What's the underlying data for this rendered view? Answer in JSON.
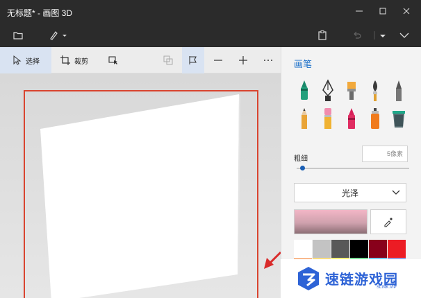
{
  "window": {
    "title": "无标题* - 画图 3D"
  },
  "toolbar": {
    "select_label": "选择",
    "crop_label": "裁剪"
  },
  "panel": {
    "title": "画笔",
    "thickness_label": "粗细",
    "thickness_value": "5像素",
    "thickness_fraction": 0.03,
    "material": "光泽",
    "brushes": [
      "marker-icon",
      "calligraphy-pen-icon",
      "oil-brush-icon",
      "watercolor-icon",
      "pixel-pen-icon",
      "pencil-icon",
      "eraser-icon",
      "crayon-icon",
      "spray-can-icon",
      "fill-bucket-icon"
    ],
    "palette": [
      "#ffffff",
      "#c3c3c3",
      "#585858",
      "#000000",
      "#88001b",
      "#ec1c24",
      "#ff7f27",
      "#ffc90e",
      "#fff200",
      "#0ed145",
      "#00a8f3",
      "#3f48cc"
    ]
  },
  "watermark": {
    "text": "速链游戏园",
    "sub": "SLINK.VIP"
  },
  "colors": {
    "accent": "#1a6fc9",
    "selection": "#d9442f",
    "arrow": "#d92b2b"
  }
}
